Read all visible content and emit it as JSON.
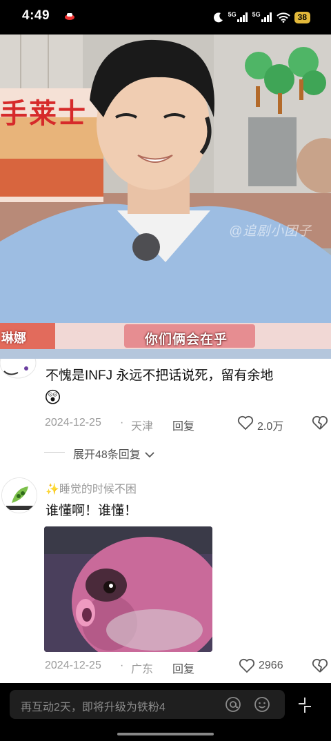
{
  "status_bar": {
    "time": "4:49",
    "network_1": "5G",
    "network_2": "5G",
    "battery": "38"
  },
  "video": {
    "shop_sign": "手莱士",
    "caption": "你们俩会在乎",
    "name_tag": "琳娜",
    "watermark": "@追剧小团子"
  },
  "comments": [
    {
      "text": "不愧是INFJ   永远不把话说死，留有余地",
      "emoji": "😲",
      "date": "2024-12-25",
      "location": "天津",
      "reply_label": "回复",
      "likes": "2.0万",
      "expand_replies": "展开48条回复"
    },
    {
      "username": "✨睡觉的时候不困",
      "text": "谁懂啊！谁懂！",
      "date": "2024-12-25",
      "location": "广东",
      "reply_label": "回复",
      "likes": "2966"
    }
  ],
  "bottom_bar": {
    "placeholder": "再互动2天，即将升级为铁粉4"
  },
  "icons": {
    "like": "heart-icon",
    "dislike": "broken-heart-icon",
    "mention": "at-icon",
    "emoji": "smiley-icon",
    "expand": "collapse-arrows-icon"
  }
}
